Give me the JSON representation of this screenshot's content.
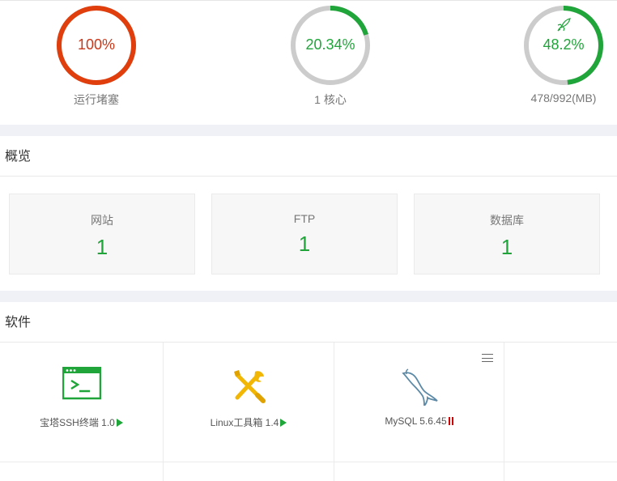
{
  "status": {
    "gauges": [
      {
        "percent": "100%",
        "caption": "运行堵塞",
        "value": 1.0,
        "color": "#e03e0c"
      },
      {
        "percent": "20.34%",
        "caption": "1 核心",
        "value": 0.2034,
        "color": "#20a53a"
      },
      {
        "percent": "48.2%",
        "caption": "478/992(MB)",
        "value": 0.482,
        "color": "#20a53a",
        "icon": "rocket-icon"
      }
    ]
  },
  "overview": {
    "title": "概览",
    "cards": [
      {
        "label": "网站",
        "value": "1"
      },
      {
        "label": "FTP",
        "value": "1"
      },
      {
        "label": "数据库",
        "value": "1"
      }
    ]
  },
  "software": {
    "title": "软件",
    "items": [
      {
        "name": "宝塔SSH终端 1.0",
        "icon": "terminal-icon",
        "state": "play"
      },
      {
        "name": "Linux工具箱 1.4",
        "icon": "tools-icon",
        "state": "play"
      },
      {
        "name": "MySQL 5.6.45",
        "icon": "mysql-dolphin-icon",
        "state": "pause"
      }
    ]
  },
  "colors": {
    "accent": "#20a53a",
    "danger": "#e03e0c",
    "track": "#cccccc"
  }
}
